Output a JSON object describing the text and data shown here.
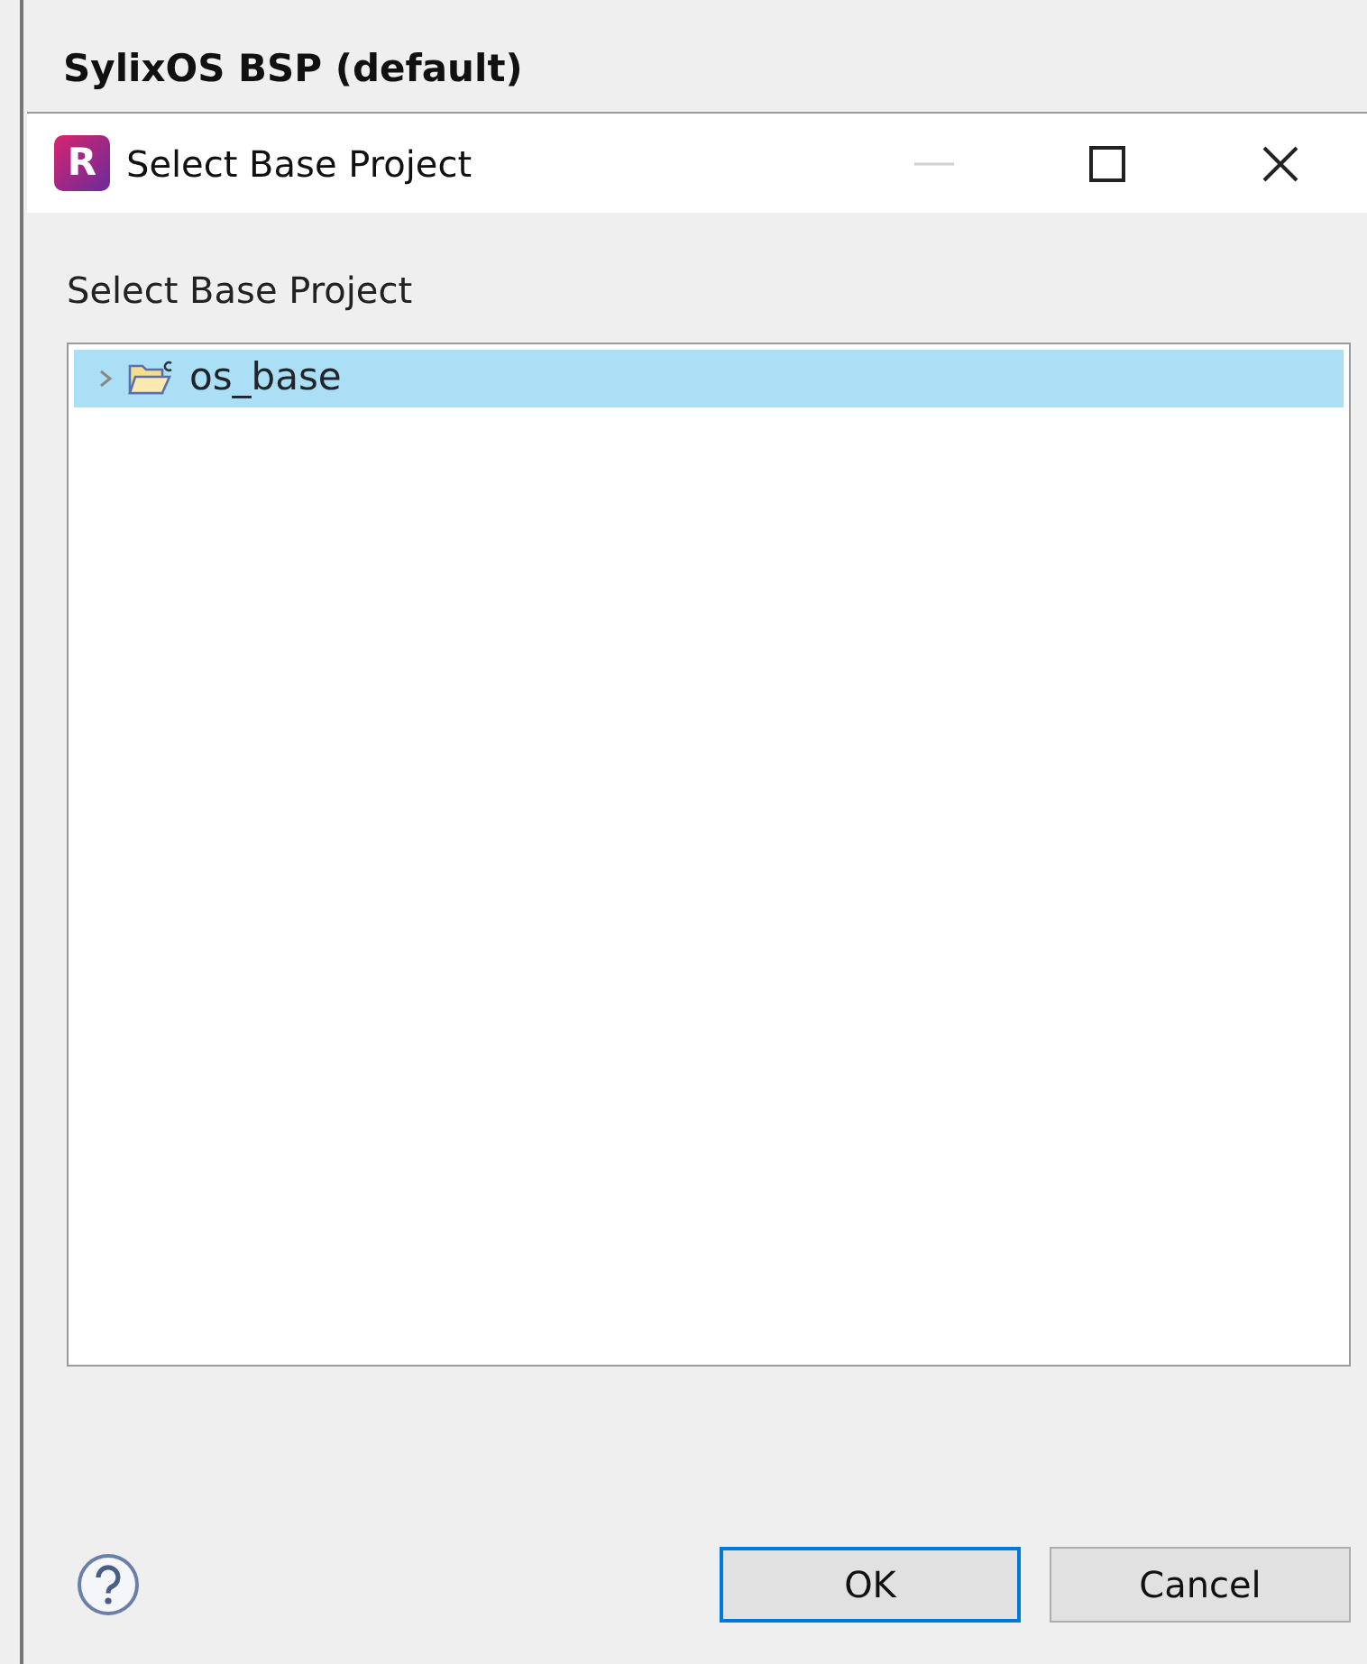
{
  "background_window": {
    "title": "SylixOS BSP (default)"
  },
  "dialog": {
    "app_badge": "R",
    "title": "Select Base Project",
    "window_controls": [
      {
        "kind": "minimize",
        "disabled": true
      },
      {
        "kind": "maximize",
        "disabled": false
      },
      {
        "kind": "close",
        "disabled": false
      }
    ],
    "label": "Select Base Project",
    "tree": [
      {
        "label": "os_base",
        "selected": true,
        "expanded": false
      }
    ],
    "buttons": [
      {
        "label": "OK",
        "default": true
      },
      {
        "label": "Cancel",
        "default": false
      }
    ]
  }
}
